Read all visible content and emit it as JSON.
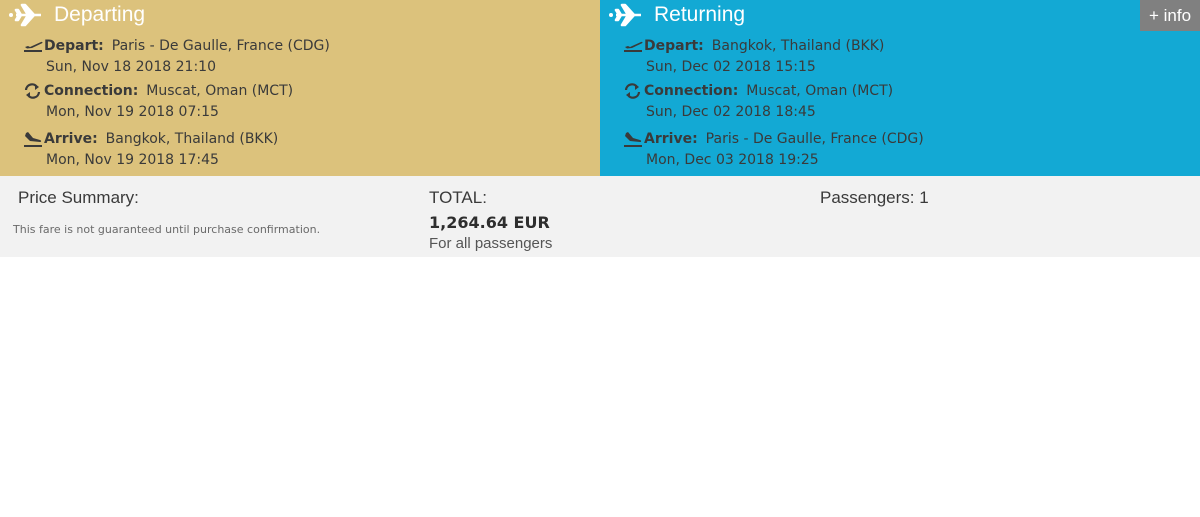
{
  "departing": {
    "title": "Departing",
    "segments": [
      {
        "icon": "takeoff-icon",
        "label": "Depart:",
        "value": "Paris - De Gaulle, France (CDG)",
        "datetime": "Sun, Nov 18 2018 21:10"
      },
      {
        "icon": "connection-icon",
        "label": "Connection:",
        "value": "Muscat, Oman (MCT)",
        "datetime": "Mon, Nov 19 2018 07:15"
      },
      {
        "icon": "landing-icon",
        "label": "Arrive:",
        "value": "Bangkok, Thailand (BKK)",
        "datetime": "Mon, Nov 19 2018 17:45"
      }
    ]
  },
  "returning": {
    "title": "Returning",
    "segments": [
      {
        "icon": "takeoff-icon",
        "label": "Depart:",
        "value": "Bangkok, Thailand (BKK)",
        "datetime": "Sun, Dec 02 2018 15:15"
      },
      {
        "icon": "connection-icon",
        "label": "Connection:",
        "value": "Muscat, Oman (MCT)",
        "datetime": "Sun, Dec 02 2018 18:45"
      },
      {
        "icon": "landing-icon",
        "label": "Arrive:",
        "value": "Paris - De Gaulle, France (CDG)",
        "datetime": "Mon, Dec 03 2018 19:25"
      }
    ],
    "info_button": "+ info"
  },
  "summary": {
    "title": "Price Summary:",
    "note": "This fare is not guaranteed until purchase confirmation.",
    "total_label": "TOTAL:",
    "total_amount": "1,264.64 EUR",
    "total_sub": "For all passengers",
    "passengers": "Passengers: 1"
  },
  "colors": {
    "departing_bg": "#dcc27c",
    "returning_bg": "#13a9d4",
    "summary_bg": "#f2f2f2",
    "info_bg": "#808080"
  }
}
